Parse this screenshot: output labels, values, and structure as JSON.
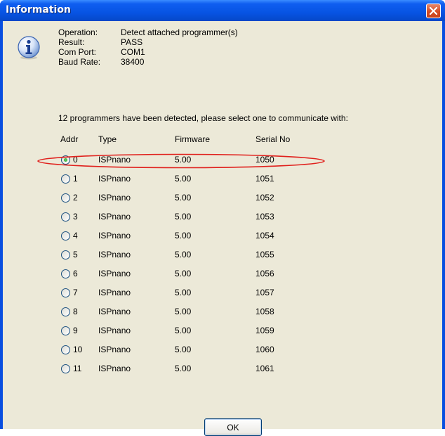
{
  "window": {
    "title": "Information",
    "close_icon": "close-icon"
  },
  "icon": "info-icon",
  "info": {
    "operation_label": "Operation:",
    "operation_value": "Detect attached programmer(s)",
    "result_label": "Result:",
    "result_value": "PASS",
    "com_port_label": "Com Port:",
    "com_port_value": "COM1",
    "baud_rate_label": "Baud Rate:",
    "baud_rate_value": "38400"
  },
  "message": "12 programmers have been detected, please select one to communicate with:",
  "table": {
    "headers": {
      "addr": "Addr",
      "type": "Type",
      "firmware": "Firmware",
      "serial": "Serial No"
    },
    "rows": [
      {
        "addr": "0",
        "type": "ISPnano",
        "firmware": "5.00",
        "serial": "1050",
        "selected": true
      },
      {
        "addr": "1",
        "type": "ISPnano",
        "firmware": "5.00",
        "serial": "1051",
        "selected": false
      },
      {
        "addr": "2",
        "type": "ISPnano",
        "firmware": "5.00",
        "serial": "1052",
        "selected": false
      },
      {
        "addr": "3",
        "type": "ISPnano",
        "firmware": "5.00",
        "serial": "1053",
        "selected": false
      },
      {
        "addr": "4",
        "type": "ISPnano",
        "firmware": "5.00",
        "serial": "1054",
        "selected": false
      },
      {
        "addr": "5",
        "type": "ISPnano",
        "firmware": "5.00",
        "serial": "1055",
        "selected": false
      },
      {
        "addr": "6",
        "type": "ISPnano",
        "firmware": "5.00",
        "serial": "1056",
        "selected": false
      },
      {
        "addr": "7",
        "type": "ISPnano",
        "firmware": "5.00",
        "serial": "1057",
        "selected": false
      },
      {
        "addr": "8",
        "type": "ISPnano",
        "firmware": "5.00",
        "serial": "1058",
        "selected": false
      },
      {
        "addr": "9",
        "type": "ISPnano",
        "firmware": "5.00",
        "serial": "1059",
        "selected": false
      },
      {
        "addr": "10",
        "type": "ISPnano",
        "firmware": "5.00",
        "serial": "1060",
        "selected": false
      },
      {
        "addr": "11",
        "type": "ISPnano",
        "firmware": "5.00",
        "serial": "1061",
        "selected": false
      }
    ]
  },
  "ok_button": "OK",
  "colors": {
    "titlebar": "#0754e3",
    "dialog_bg": "#ece9d8",
    "highlight": "#e0201c",
    "close_button": "#d64d24"
  }
}
